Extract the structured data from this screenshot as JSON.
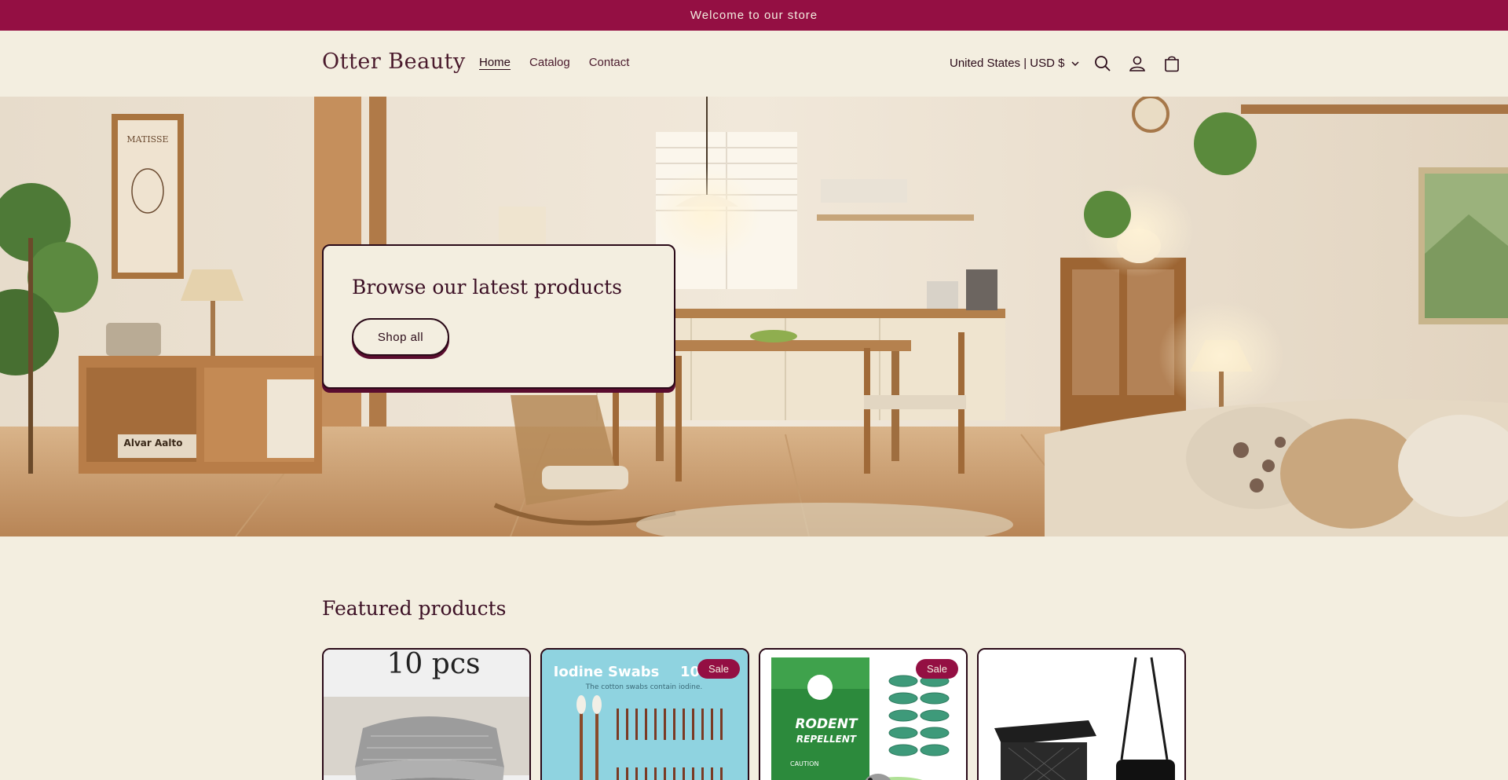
{
  "announcement": "Welcome to our store",
  "header": {
    "logo": "Otter Beauty",
    "nav": [
      "Home",
      "Catalog",
      "Contact"
    ],
    "locale": "United States | USD $",
    "icons": [
      "search-icon",
      "account-icon",
      "cart-icon"
    ]
  },
  "hero": {
    "title": "Browse our latest products",
    "button": "Shop all",
    "image_text": {
      "poster_title": "MATISSE",
      "book_title": "Alvar Aalto"
    }
  },
  "featured": {
    "title": "Featured products",
    "products": [
      {
        "badge": "",
        "image_text": "10 pcs"
      },
      {
        "badge": "Sale",
        "image_text": "Iodine Swabs",
        "image_subtext": "The cotton swabs contain iodine.",
        "image_count": "100"
      },
      {
        "badge": "Sale",
        "image_text": "RODENT",
        "image_subtext": "REPELLENT",
        "image_caution": "CAUTION"
      },
      {
        "badge": "",
        "image_text": ""
      }
    ]
  },
  "colors": {
    "accent": "#940f43",
    "background": "#f3eee0",
    "text": "#3b0f24",
    "shadow": "#5a0c2e"
  }
}
